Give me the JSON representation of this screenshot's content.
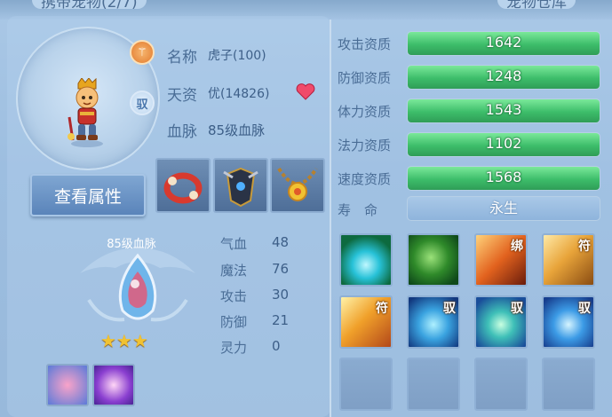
{
  "top": {
    "left_tab": "携带宠物(2/7)",
    "right_tab": "宠物仓库"
  },
  "pet": {
    "name_label": "名称",
    "name_value": "虎子(100)",
    "talent_label": "天资",
    "talent_value": "优(14826)",
    "blood_label": "血脉",
    "blood_value": "85级血脉",
    "category_icon": "talisman-icon",
    "ride_icon_text": "驭",
    "view_button": "查看属性"
  },
  "equipment": [
    {
      "name": "red-bracelet-icon"
    },
    {
      "name": "dark-armor-icon"
    },
    {
      "name": "sun-necklace-icon"
    }
  ],
  "bloodline": {
    "title": "85级血脉",
    "stars": "★★★"
  },
  "base_stats": [
    {
      "label": "气血",
      "value": "48"
    },
    {
      "label": "魔法",
      "value": "76"
    },
    {
      "label": "攻击",
      "value": "30"
    },
    {
      "label": "防御",
      "value": "21"
    },
    {
      "label": "灵力",
      "value": "0"
    }
  ],
  "aptitudes": [
    {
      "label": "攻击资质",
      "value": "1642",
      "fill": 1.0
    },
    {
      "label": "防御资质",
      "value": "1248",
      "fill": 1.0
    },
    {
      "label": "体力资质",
      "value": "1543",
      "fill": 1.0
    },
    {
      "label": "法力资质",
      "value": "1102",
      "fill": 1.0
    },
    {
      "label": "速度资质",
      "value": "1568",
      "fill": 1.0
    }
  ],
  "lifespan": {
    "label": "寿　命",
    "value": "永生"
  },
  "skills": [
    {
      "name": "water-spirit-skill-icon",
      "tag": ""
    },
    {
      "name": "green-giant-skill-icon",
      "tag": ""
    },
    {
      "name": "bind-skill-icon",
      "tag": "绑"
    },
    {
      "name": "boot-skill-icon",
      "tag": "符"
    },
    {
      "name": "sword-skill-icon",
      "tag": "符"
    },
    {
      "name": "beast-skill-icon",
      "tag": "驭"
    },
    {
      "name": "shield-skill-icon",
      "tag": "驭"
    },
    {
      "name": "tide-shield-skill-icon",
      "tag": "驭"
    }
  ],
  "colors": {
    "aptitude_fill": "#3dbd6a",
    "panel_bg": "#a5c4e3",
    "button": "#5a84ba"
  }
}
